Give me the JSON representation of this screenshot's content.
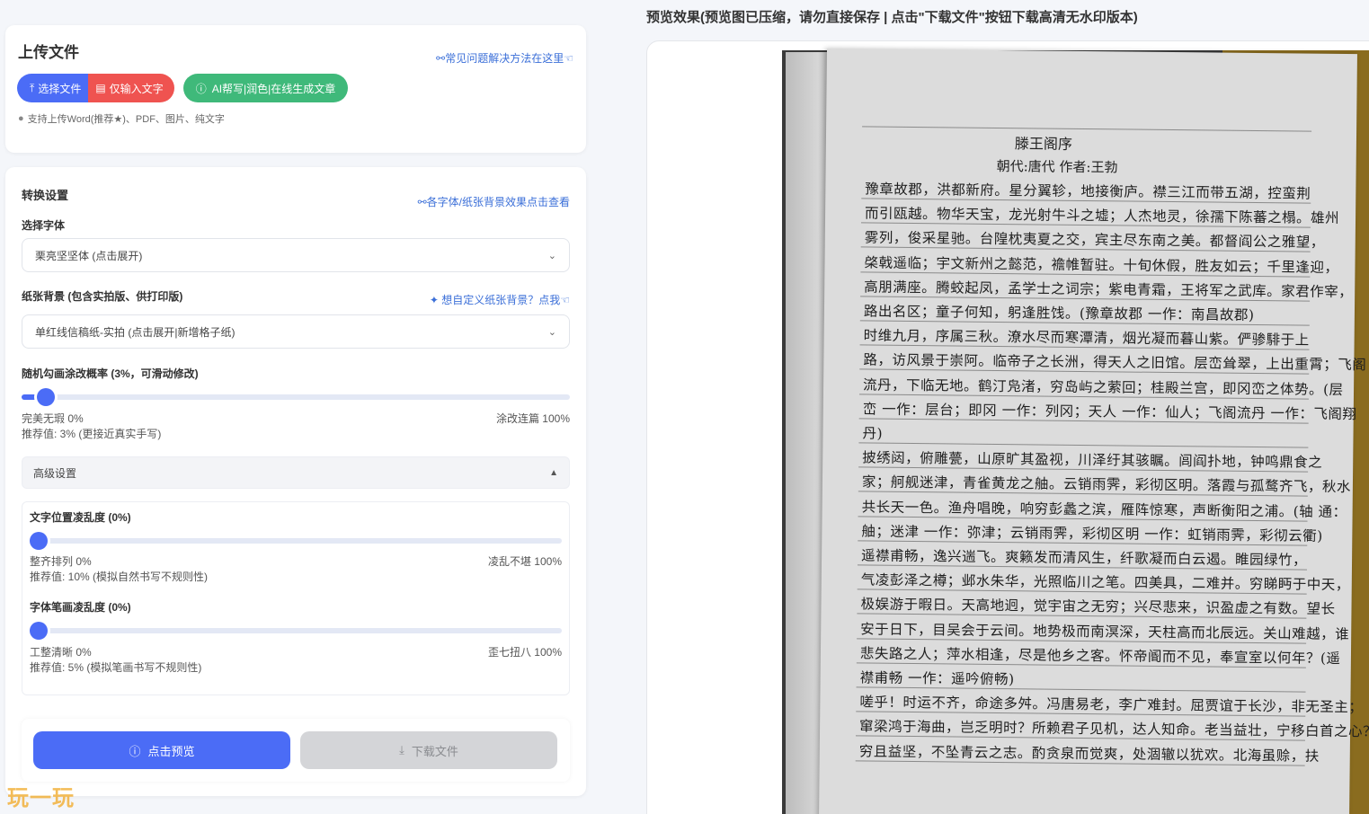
{
  "upload": {
    "title": "上传文件",
    "faq_link": "常见问题解决方法在这里",
    "btn_select": "选择文件",
    "btn_text_only": "仅输入文字",
    "btn_ai": "AI帮写|润色|在线生成文章",
    "support_note": "支持上传Word(推荐★)、PDF、图片、纯文字"
  },
  "settings": {
    "title": "转换设置",
    "font_link": "各字体/纸张背景效果点击查看",
    "font_label": "选择字体",
    "font_value": "栗亮坚坚体 (点击展开)",
    "paper_label": "纸张背景 (包含实拍版、供打印版)",
    "paper_link": "想自定义纸张背景？点我",
    "paper_value": "单红线信稿纸-实拍 (点击展开|新增格子纸)",
    "correction_label": "随机勾画涂改概率 (3%，可滑动修改)",
    "correction_value": 3,
    "correction_min": "完美无瑕 0%",
    "correction_max": "涂改连篇 100%",
    "correction_hint": "推荐值: 3% (更接近真实手写)",
    "advanced_label": "高级设置",
    "position_label": "文字位置凌乱度 (0%)",
    "position_value": 0,
    "position_min": "整齐排列 0%",
    "position_max": "凌乱不堪 100%",
    "position_hint": "推荐值: 10% (模拟自然书写不规则性)",
    "stroke_label": "字体笔画凌乱度 (0%)",
    "stroke_value": 0,
    "stroke_min": "工整清晰 0%",
    "stroke_max": "歪七扭八 100%",
    "stroke_hint": "推荐值: 5% (模拟笔画书写不规则性)",
    "btn_preview": "点击预览",
    "btn_download": "下载文件"
  },
  "watermark": "玩一玩",
  "preview": {
    "title": "预览效果(预览图已压缩，请勿直接保存 | 点击\"下载文件\"按钮下载高清无水印版本)",
    "doc_title": "滕王阁序",
    "doc_sub": "朝代:唐代 作者:王勃",
    "lines": [
      "豫章故郡，洪都新府。星分翼轸，地接衡庐。襟三江而带五湖，控蛮荆",
      "而引瓯越。物华天宝，龙光射牛斗之墟；人杰地灵，徐孺下陈蕃之榻。雄州",
      "雾列，俊采星驰。台隍枕夷夏之交，宾主尽东南之美。都督阎公之雅望，",
      "棨戟遥临；宇文新州之懿范，襜帷暂驻。十旬休假，胜友如云；千里逢迎，",
      "高朋满座。腾蛟起凤，孟学士之词宗；紫电青霜，王将军之武库。家君作宰，",
      "路出名区；童子何知，躬逢胜饯。(豫章故郡 一作：南昌故郡)",
      "时维九月，序属三秋。潦水尽而寒潭清，烟光凝而暮山紫。俨骖騑于上",
      "路，访风景于崇阿。临帝子之长洲，得天人之旧馆。层峦耸翠，上出重霄；飞阁",
      "流丹，下临无地。鹤汀凫渚，穷岛屿之萦回；桂殿兰宫，即冈峦之体势。(层",
      "峦 一作：层台；即冈 一作：列冈；天人 一作：仙人；飞阁流丹 一作：飞阁翔",
      "丹)",
      "披绣闼，俯雕甍，山原旷其盈视，川泽纡其骇瞩。闾阎扑地，钟鸣鼎食之",
      "家；舸舰迷津，青雀黄龙之舳。云销雨霁，彩彻区明。落霞与孤鹜齐飞，秋水",
      "共长天一色。渔舟唱晚，响穷彭蠡之滨，雁阵惊寒，声断衡阳之浦。(轴 通：",
      "舳；迷津 一作：弥津；云销雨霁，彩彻区明 一作：虹销雨霁，彩彻云衢)",
      "遥襟甫畅，逸兴遄飞。爽籁发而清风生，纤歌凝而白云遏。睢园绿竹，",
      "气凌彭泽之樽；邺水朱华，光照临川之笔。四美具，二难并。穷睇眄于中天，",
      "极娱游于暇日。天高地迥，觉宇宙之无穷；兴尽悲来，识盈虚之有数。望长",
      "安于日下，目吴会于云间。地势极而南溟深，天柱高而北辰远。关山难越，谁",
      "悲失路之人；萍水相逢，尽是他乡之客。怀帝阍而不见，奉宣室以何年？(遥",
      "襟甫畅 一作：遥吟俯畅)",
      "嗟乎！时运不齐，命途多舛。冯唐易老，李广难封。屈贾谊于长沙，非无圣主；",
      "窜梁鸿于海曲，岂乏明时？所赖君子见机，达人知命。老当益壮，宁移白首之心？",
      "穷且益坚，不坠青云之志。酌贪泉而觉爽，处涸辙以犹欢。北海虽赊，扶"
    ]
  },
  "colors": {
    "primary": "#4b6cf6",
    "danger": "#ef5350",
    "success": "#3fb97a",
    "link": "#3b6fd8",
    "disabled": "#d4d5d8"
  }
}
